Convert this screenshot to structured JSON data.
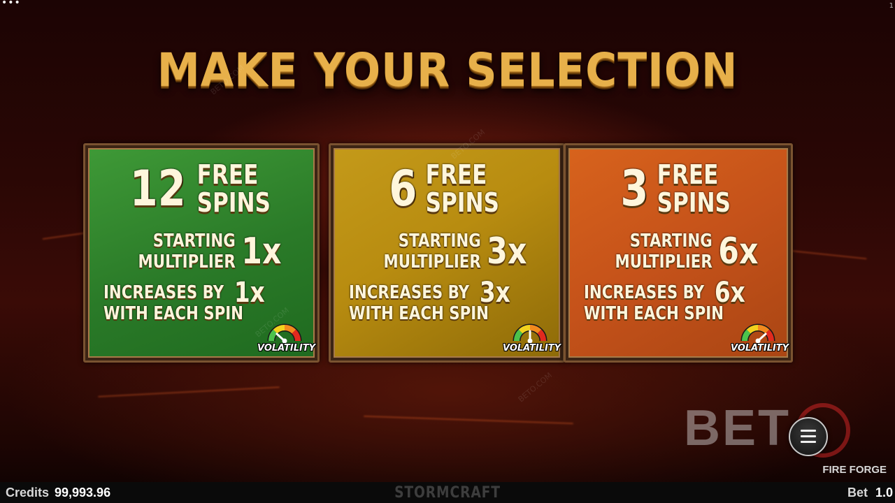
{
  "game": {
    "title": "MAKE YOUR SELECTION",
    "name": "FIRE FORGE",
    "brand": "STORMCRAFT",
    "top_left_dots": "•••",
    "top_right_mark": "1"
  },
  "options": [
    {
      "spins": "12",
      "free_line1": "FREE",
      "free_line2": "SPINS",
      "mult_line1": "STARTING",
      "mult_line2": "MULTIPLIER",
      "mult_value": "1x",
      "inc_text": "INCREASES BY",
      "inc_value": "1x",
      "inc_line2": "WITH EACH SPIN",
      "volatility_label": "VOLATILITY",
      "volatility_level": 0.2,
      "color": "#2f8a2c"
    },
    {
      "spins": "6",
      "free_line1": "FREE",
      "free_line2": "SPINS",
      "mult_line1": "STARTING",
      "mult_line2": "MULTIPLIER",
      "mult_value": "3x",
      "inc_text": "INCREASES BY",
      "inc_value": "3x",
      "inc_line2": "WITH EACH SPIN",
      "volatility_label": "VOLATILITY",
      "volatility_level": 0.5,
      "color": "#b88c10"
    },
    {
      "spins": "3",
      "free_line1": "FREE",
      "free_line2": "SPINS",
      "mult_line1": "STARTING",
      "mult_line2": "MULTIPLIER",
      "mult_value": "6x",
      "inc_text": "INCREASES BY",
      "inc_value": "6x",
      "inc_line2": "WITH EACH SPIN",
      "volatility_label": "VOLATILITY",
      "volatility_level": 0.8,
      "color": "#c5521a"
    }
  ],
  "watermark": {
    "logo_text": "BET",
    "small_text": "BETO.COM"
  },
  "footer": {
    "credits_label": "Credits",
    "credits_value": "99,993.96",
    "bet_label": "Bet",
    "bet_value": "1.0"
  },
  "icons": {
    "menu": "hamburger-menu-icon",
    "volatility": "gauge-icon"
  },
  "colors": {
    "title": "#e7b04a",
    "card_border": "#7a5330",
    "background": "#2a0705"
  }
}
